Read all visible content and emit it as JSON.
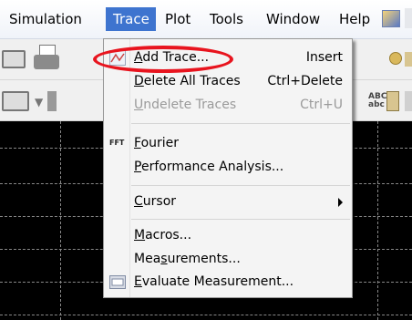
{
  "menubar": {
    "items": [
      {
        "label": "Simulation",
        "active": false
      },
      {
        "label": "Trace",
        "active": true
      },
      {
        "label": "Plot",
        "active": false
      },
      {
        "label": "Tools",
        "active": false
      },
      {
        "label": "Window",
        "active": false
      },
      {
        "label": "Help",
        "active": false
      }
    ]
  },
  "toolbar": {
    "abc_label": "ABC\nabc"
  },
  "trace_menu": {
    "add_trace": {
      "label": "Add Trace...",
      "mnemonic": "A",
      "shortcut": "Insert"
    },
    "delete_all_traces": {
      "label": "Delete All Traces",
      "mnemonic": "D",
      "shortcut": "Ctrl+Delete"
    },
    "undelete_traces": {
      "label": "Undelete Traces",
      "mnemonic": "U",
      "shortcut": "Ctrl+U",
      "disabled": true
    },
    "fourier": {
      "label": "Fourier",
      "mnemonic": "F",
      "icon_text": "FFT"
    },
    "performance_analysis": {
      "label": "Performance Analysis...",
      "mnemonic": "P"
    },
    "cursor": {
      "label": "Cursor",
      "mnemonic": "C",
      "has_submenu": true
    },
    "macros": {
      "label": "Macros...",
      "mnemonic": "M"
    },
    "measurements": {
      "label": "Measurements...",
      "mnemonic": "s"
    },
    "evaluate_measurement": {
      "label": "Evaluate Measurement...",
      "mnemonic": "E"
    }
  },
  "colors": {
    "menu_active_bg": "#3e74cf",
    "highlight_ring": "#e8141e",
    "plot_bg": "#000000"
  }
}
